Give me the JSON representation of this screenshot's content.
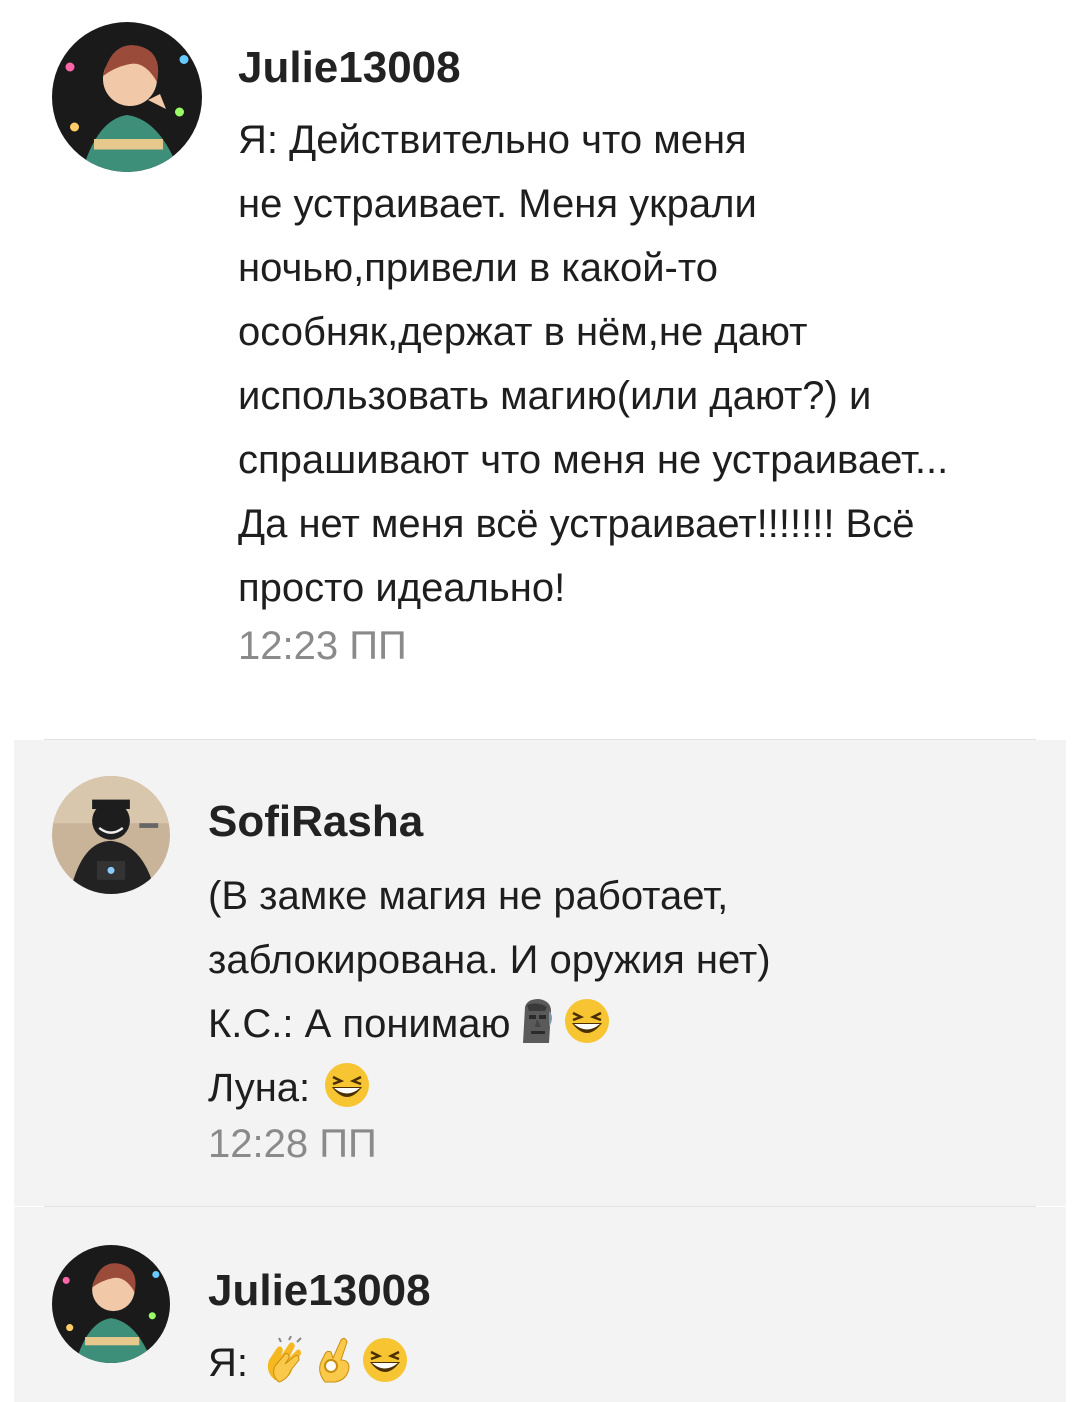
{
  "messages": [
    {
      "username": "Julie13008",
      "lines": [
        "Я: Действительно что меня",
        "не устраивает. Меня украли",
        "ночью,привели в какой-то",
        "особняк,держат в нём,не дают",
        "использовать магию(или дают?) и",
        "спрашивают что меня не устраивает...",
        "Да нет меня всё устраивает!!!!!!! Всё",
        "просто идеально!"
      ],
      "time": "12:23 ПП"
    },
    {
      "username": "SofiRasha",
      "lines": [
        "(В замке магия не работает,",
        "заблокирована. И оружия нет)",
        "К.С.: А понимаю",
        "Луна: "
      ],
      "line3_emojis": [
        "moai-emoji",
        "grinning-squint-emoji"
      ],
      "line4_emojis": [
        "grinning-squint-emoji"
      ],
      "time": "12:28 ПП"
    },
    {
      "username": "Julie13008",
      "lines": [
        "Я: "
      ],
      "line1_emojis": [
        "clapping-hands-emoji",
        "ok-hand-emoji",
        "grinning-squint-emoji"
      ]
    }
  ],
  "colors": {
    "panel_bg": "#f3f3f3",
    "time": "#8a8a8a",
    "text": "#1e1e1e"
  }
}
